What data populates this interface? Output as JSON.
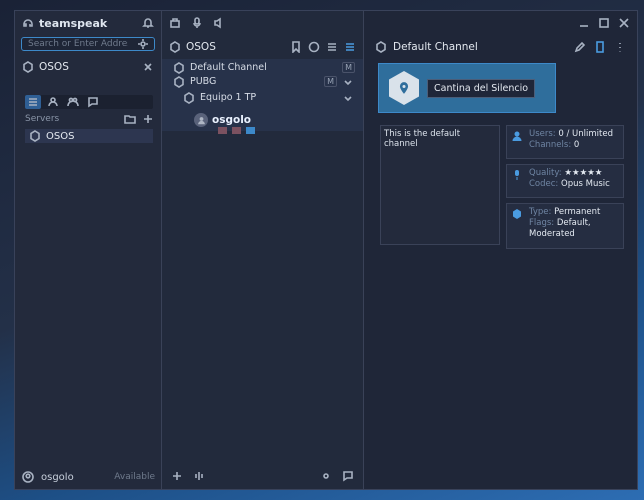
{
  "app": {
    "brand": "teamspeak",
    "search_placeholder": "Search or Enter Address"
  },
  "left": {
    "title": "OSOS",
    "servers_label": "Servers",
    "server_item": "OSOS",
    "footer_user": "osgolo",
    "footer_status": "Available"
  },
  "middle": {
    "header_title": "OSOS",
    "tree": [
      {
        "label": "Default Channel",
        "badge": "M"
      },
      {
        "label": "PUBG",
        "badge": "M"
      },
      {
        "label": "Equipo 1 TP"
      }
    ],
    "user": "osgolo"
  },
  "right": {
    "header_title": "Default Channel",
    "banner_name": "Cantina del Silencio",
    "description": "This is the default channel",
    "users_key": "Users:",
    "users_val": "0 / Unlimited",
    "channels_key": "Channels:",
    "channels_val": "0",
    "quality_key": "Quality:",
    "quality_val": "★★★★★",
    "codec_key": "Codec:",
    "codec_val": "Opus Music",
    "type_key": "Type:",
    "type_val": "Permanent",
    "flags_key": "Flags:",
    "flags_val": "Default, Moderated"
  }
}
